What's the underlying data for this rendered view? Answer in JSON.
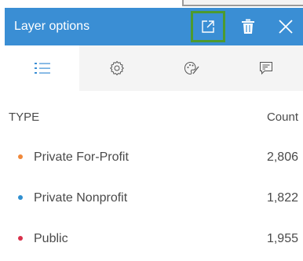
{
  "panel": {
    "title": "Layer options",
    "header_color": "#3a8ed4",
    "highlight_color": "#4d9a2e"
  },
  "header_buttons": [
    {
      "icon": "popout-icon"
    },
    {
      "icon": "trash-icon"
    },
    {
      "icon": "close-icon"
    }
  ],
  "tabs": [
    {
      "icon": "legend-list-icon",
      "active": true,
      "color": "#3a8ed4"
    },
    {
      "icon": "gear-icon",
      "active": false
    },
    {
      "icon": "palette-icon",
      "active": false
    },
    {
      "icon": "popup-icon",
      "active": false
    }
  ],
  "table": {
    "type_header": "TYPE",
    "count_header": "Count",
    "rows": [
      {
        "label": "Private For-Profit",
        "value": "2,806",
        "color": "#f0883a"
      },
      {
        "label": "Private Nonprofit",
        "value": "1,822",
        "color": "#2f8fd0"
      },
      {
        "label": "Public",
        "value": "1,955",
        "color": "#d8304a"
      }
    ]
  }
}
